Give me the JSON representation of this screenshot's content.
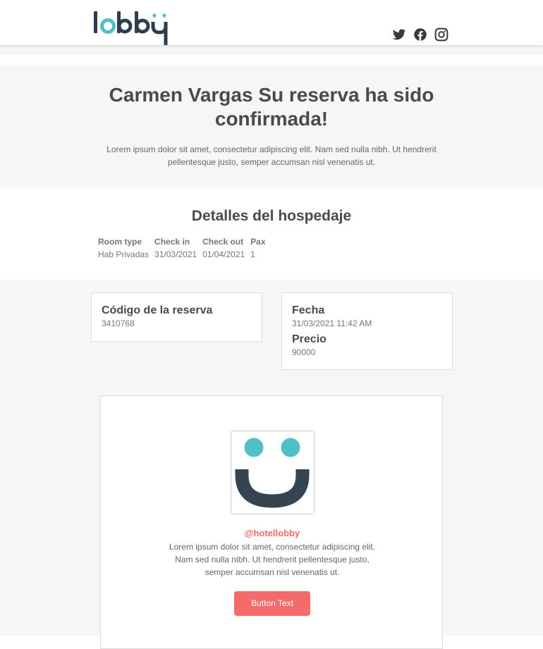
{
  "header": {
    "logo_text": "lobby",
    "social": [
      {
        "name": "twitter-icon"
      },
      {
        "name": "facebook-icon"
      },
      {
        "name": "instagram-icon"
      }
    ]
  },
  "hero": {
    "title": "Carmen Vargas Su reserva ha sido confirmada!",
    "body": "Lorem ipsum dolor sit amet, consectetur adipiscing elit. Nam sed nulla nibh. Ut hendrerit pellentesque justo, semper accumsan nisl venenatis ut."
  },
  "details": {
    "title": "Detalles del hospedaje",
    "columns": [
      "Room type",
      "Check in",
      "Check out",
      "Pax"
    ],
    "row": [
      "Hab Privadas",
      "31/03/2021",
      "01/04/2021",
      "1"
    ]
  },
  "reservation": {
    "code_label": "Código de la reserva",
    "code_value": "3410768"
  },
  "summary": {
    "date_label": "Fecha",
    "date_value": "31/03/2021 11:42 AM",
    "price_label": "Precio",
    "price_value": "90000"
  },
  "promo": {
    "handle": "@hotellobby",
    "body": "Lorem ipsum dolor sit amet, consectetur adipiscing elit. Nam sed nulla nibh. Ut hendrerit pellentesque justo, semper accumsan nisl venenatis ut.",
    "button_label": "Button Text"
  },
  "colors": {
    "brand_dark": "#2e3e4e",
    "brand_teal": "#4fc0c5",
    "accent_coral": "#f56b6b",
    "panel_bg": "#f6f6f6"
  }
}
